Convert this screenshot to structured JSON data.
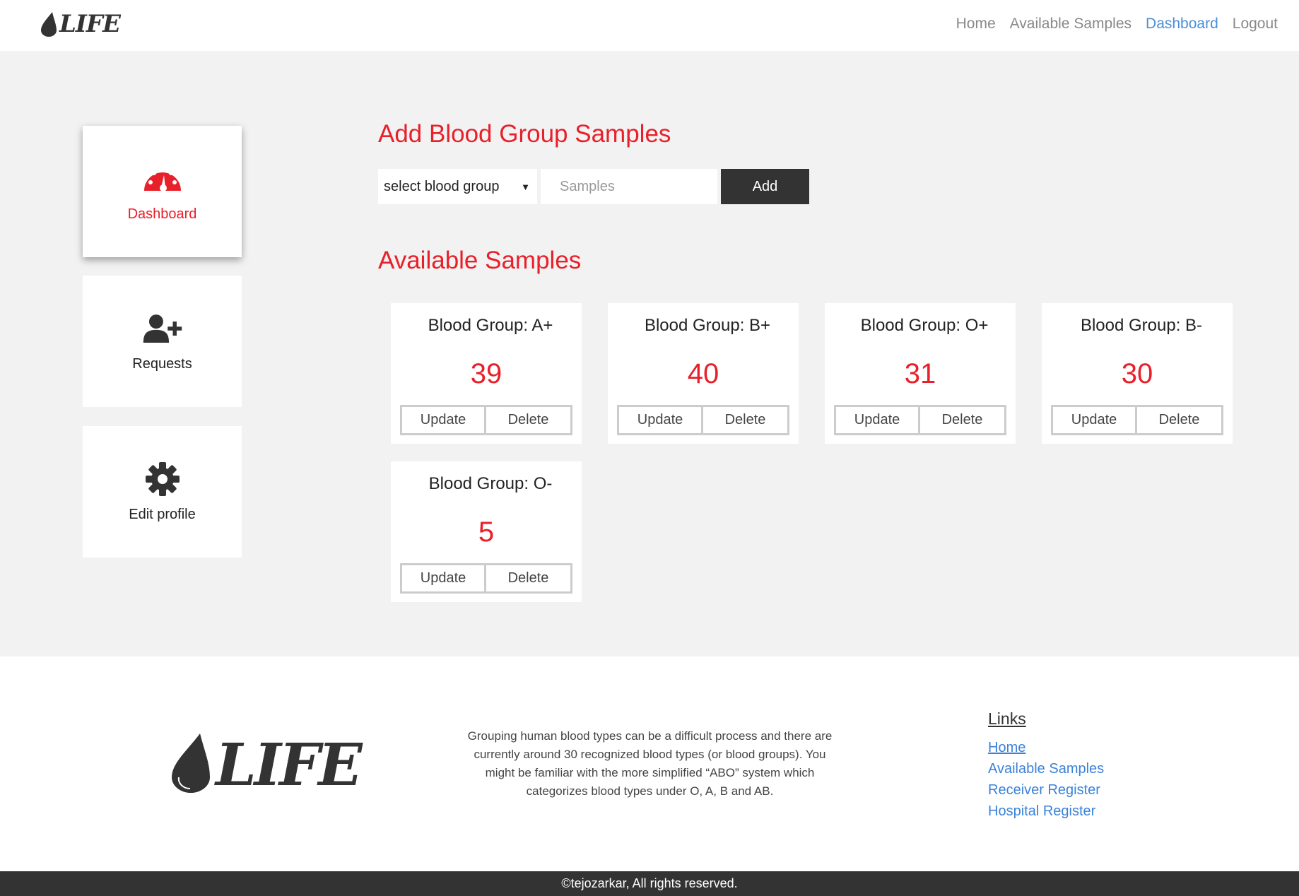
{
  "brand": {
    "logo_text": "LIFE",
    "accent": "#e8202a",
    "dark": "#333333",
    "link": "#3b82d9"
  },
  "nav": {
    "items": [
      {
        "label": "Home",
        "active": false
      },
      {
        "label": "Available Samples",
        "active": false
      },
      {
        "label": "Dashboard",
        "active": true
      },
      {
        "label": "Logout",
        "active": false
      }
    ]
  },
  "sidebar": {
    "items": [
      {
        "label": "Dashboard",
        "icon": "speedometer-icon",
        "active": true
      },
      {
        "label": "Requests",
        "icon": "user-plus-icon",
        "active": false
      },
      {
        "label": "Edit profile",
        "icon": "gear-icon",
        "active": false
      }
    ]
  },
  "add_section": {
    "title": "Add Blood Group Samples",
    "select_value": "select blood group",
    "samples_placeholder": "Samples",
    "add_label": "Add"
  },
  "available": {
    "title": "Available Samples",
    "cards": [
      {
        "group": "Blood Group: A+",
        "count": "39"
      },
      {
        "group": "Blood Group: B+",
        "count": "40"
      },
      {
        "group": "Blood Group: O+",
        "count": "31"
      },
      {
        "group": "Blood Group: B-",
        "count": "30"
      },
      {
        "group": "Blood Group: O-",
        "count": "5"
      }
    ],
    "update_label": "Update",
    "delete_label": "Delete"
  },
  "footer": {
    "logo_text": "LIFE",
    "description": "Grouping human blood types can be a difficult process and there are currently around 30 recognized blood types (or blood groups). You might be familiar with the more simplified “ABO” system which categorizes blood types under O, A, B and AB.",
    "links_heading": "Links",
    "links": [
      "Home",
      "Available Samples",
      "Receiver Register",
      "Hospital Register"
    ],
    "copyright": "©tejozarkar, All rights reserved."
  }
}
